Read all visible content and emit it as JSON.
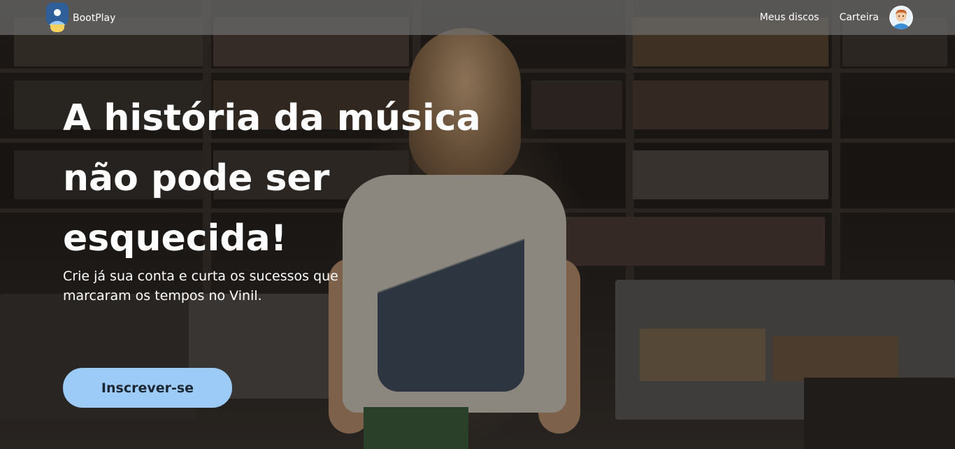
{
  "brand": {
    "name": "BootPlay"
  },
  "nav": {
    "links": [
      {
        "label": "Meus discos"
      },
      {
        "label": "Carteira"
      }
    ]
  },
  "hero": {
    "headline": "A história da música não pode ser esquecida!",
    "subtitle": "Crie já sua conta e curta os sucessos que marcaram os tempos no Vinil.",
    "cta_label": "Inscrever-se"
  },
  "colors": {
    "navbar_bg": "#6e6e6e",
    "cta_bg": "#9ccbf7",
    "cta_text": "#1c2733",
    "text": "#ffffff"
  },
  "icons": {
    "brand": "user-logo-icon",
    "avatar": "user-avatar-icon"
  }
}
